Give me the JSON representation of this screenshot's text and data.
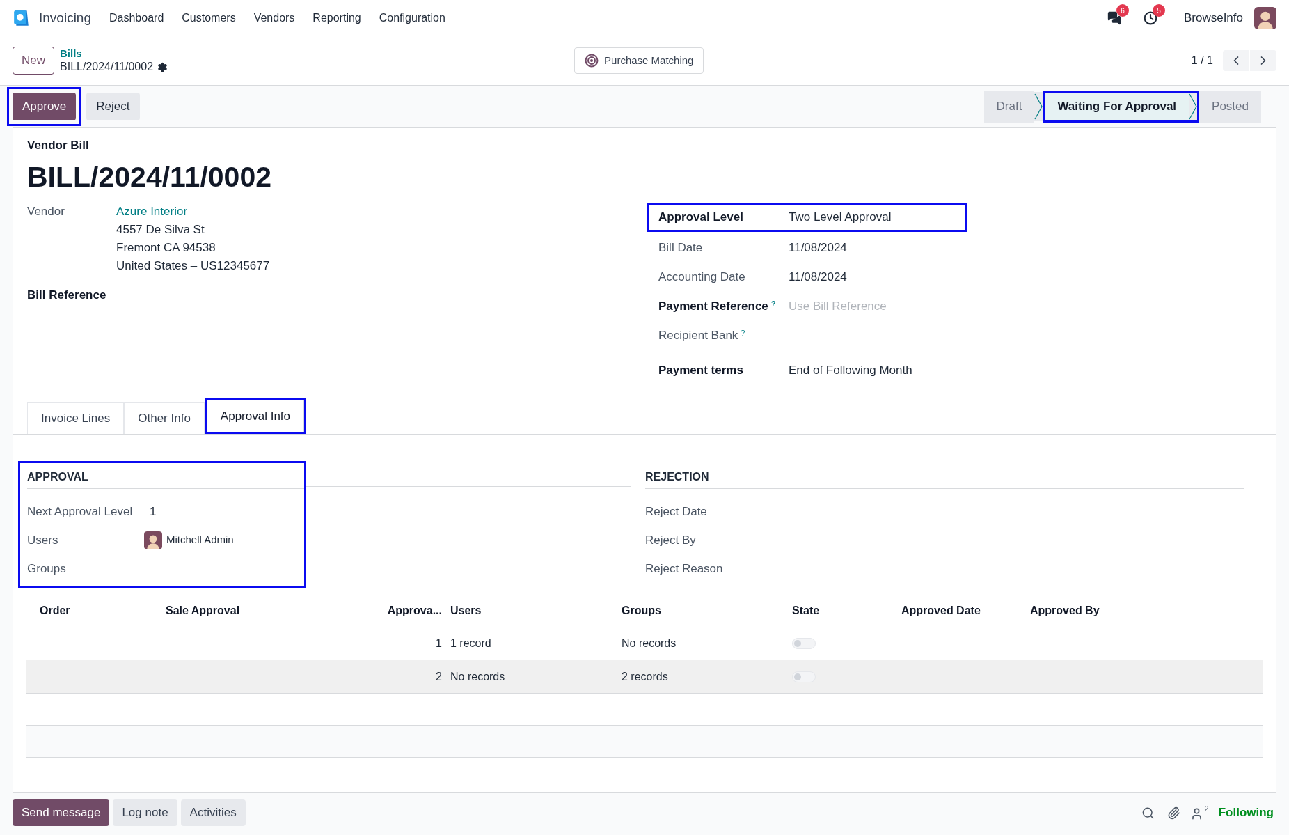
{
  "navbar": {
    "app": "Invoicing",
    "menu": [
      "Dashboard",
      "Customers",
      "Vendors",
      "Reporting",
      "Configuration"
    ],
    "messages_count": "6",
    "activities_count": "5",
    "company": "BrowseInfo"
  },
  "control_panel": {
    "new_button": "New",
    "breadcrumb": "Bills",
    "record": "BILL/2024/11/0002",
    "smart_button": "Purchase Matching",
    "pager": "1 / 1"
  },
  "actions": [
    {
      "label": "Approve",
      "kind": "primary",
      "highlighted": true
    },
    {
      "label": "Reject",
      "kind": "secondary",
      "highlighted": false
    }
  ],
  "statusbar": [
    {
      "label": "Draft",
      "selected": false,
      "highlighted": false
    },
    {
      "label": "Waiting For Approval",
      "selected": true,
      "highlighted": true
    },
    {
      "label": "Posted",
      "selected": false,
      "highlighted": false
    }
  ],
  "form": {
    "type_label": "Vendor Bill",
    "title": "BILL/2024/11/0002",
    "vendor": {
      "label": "Vendor",
      "name": "Azure Interior",
      "address": [
        "4557 De Silva St",
        "Fremont CA 94538",
        "United States – US12345677"
      ]
    },
    "bill_reference": {
      "label": "Bill Reference"
    },
    "right_fields": [
      {
        "label": "Approval Level",
        "value": "Two Level Approval",
        "required": true,
        "highlighted": true
      },
      {
        "label": "Bill Date",
        "value": "11/08/2024",
        "required": false,
        "highlighted": false
      },
      {
        "label": "Accounting Date",
        "value": "11/08/2024",
        "required": false,
        "highlighted": false
      },
      {
        "label": "Payment Reference",
        "help": "?",
        "placeholder": "Use Bill Reference",
        "required": true,
        "highlighted": false
      },
      {
        "label": "Recipient Bank",
        "help": "?",
        "required": false,
        "highlighted": false
      },
      {
        "label": "Payment terms",
        "value": "End of Following Month",
        "required": true,
        "highlighted": false
      }
    ]
  },
  "tabs": [
    {
      "label": "Invoice Lines",
      "selected": false,
      "highlighted": false
    },
    {
      "label": "Other Info",
      "selected": false,
      "highlighted": false
    },
    {
      "label": "Approval Info",
      "selected": true,
      "highlighted": true
    }
  ],
  "approval": {
    "title": "APPROVAL",
    "highlighted": true,
    "fields": [
      {
        "label": "Next Approval Level",
        "value": "1"
      },
      {
        "label": "Users",
        "user": "Mitchell Admin"
      },
      {
        "label": "Groups"
      }
    ]
  },
  "rejection": {
    "title": "REJECTION",
    "fields": [
      {
        "label": "Reject Date"
      },
      {
        "label": "Reject By"
      },
      {
        "label": "Reject Reason"
      }
    ]
  },
  "table": {
    "columns": [
      "Order",
      "Sale Approval",
      "Approva...",
      "Users",
      "Groups",
      "State",
      "Approved Date",
      "Approved By"
    ],
    "rows": [
      {
        "approval": "1",
        "users": "1 record",
        "groups": "No records",
        "on": false,
        "hovered": false
      },
      {
        "approval": "2",
        "users": "No records",
        "groups": "2 records",
        "on": false,
        "hovered": true
      }
    ]
  },
  "chatter": {
    "buttons": [
      {
        "label": "Send message",
        "kind": "primary"
      },
      {
        "label": "Log note",
        "kind": "secondary"
      },
      {
        "label": "Activities",
        "kind": "secondary"
      }
    ],
    "followers_count": "2",
    "follow_label": "Following"
  }
}
